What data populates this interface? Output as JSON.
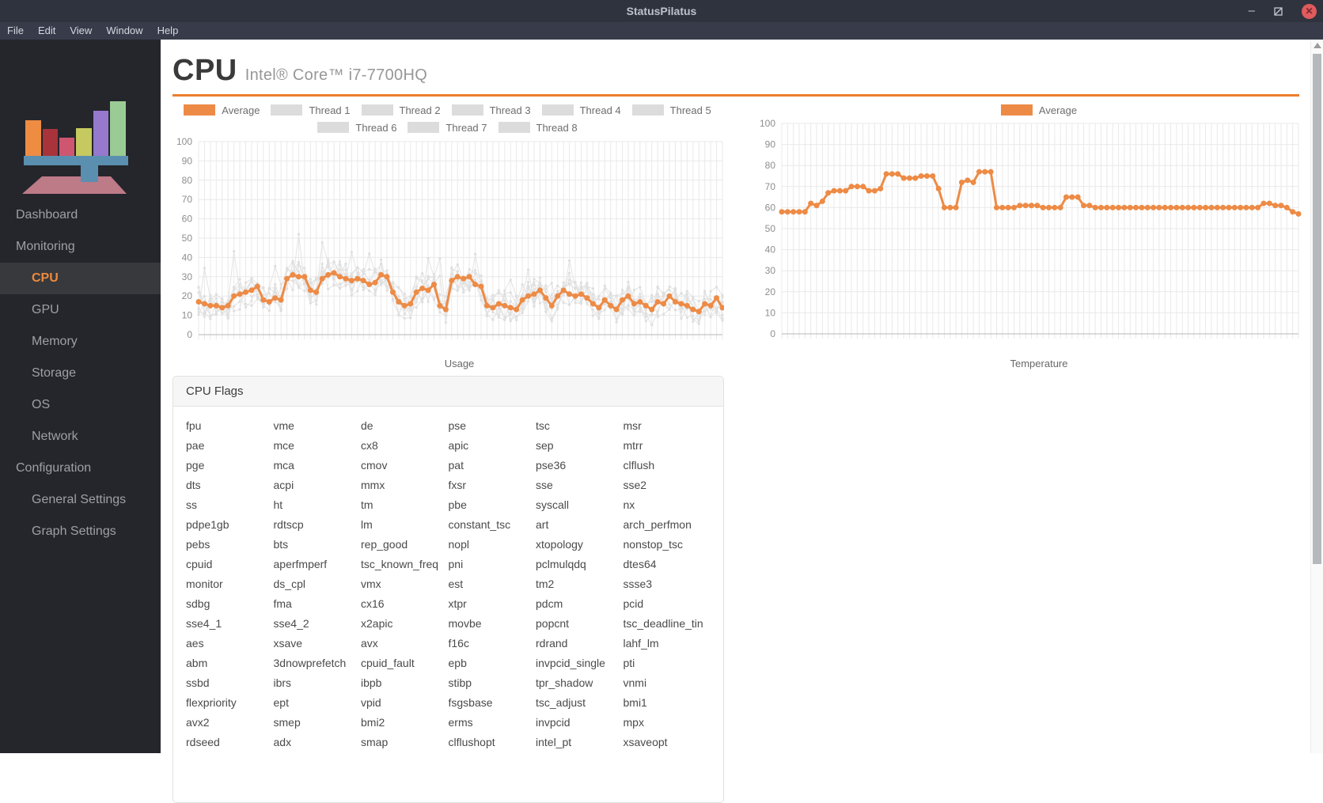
{
  "window": {
    "title": "StatusPilatus",
    "minimize_label": "–",
    "close_label": "✕"
  },
  "menu": {
    "items": [
      "File",
      "Edit",
      "View",
      "Window",
      "Help"
    ]
  },
  "sidebar": {
    "items": [
      {
        "label": "Dashboard",
        "level": 0,
        "selected": false
      },
      {
        "label": "Monitoring",
        "level": 0,
        "selected": false
      },
      {
        "label": "CPU",
        "level": 1,
        "selected": true
      },
      {
        "label": "GPU",
        "level": 1,
        "selected": false
      },
      {
        "label": "Memory",
        "level": 1,
        "selected": false
      },
      {
        "label": "Storage",
        "level": 1,
        "selected": false
      },
      {
        "label": "OS",
        "level": 1,
        "selected": false
      },
      {
        "label": "Network",
        "level": 1,
        "selected": false
      },
      {
        "label": "Configuration",
        "level": 0,
        "selected": false
      },
      {
        "label": "General Settings",
        "level": 1,
        "selected": false
      },
      {
        "label": "Graph Settings",
        "level": 1,
        "selected": false
      }
    ]
  },
  "page": {
    "title": "CPU",
    "subtitle": "Intel® Core™ i7-7700HQ"
  },
  "colors": {
    "accent_orange": "#ed8b46",
    "rule_orange": "#ec7f2f",
    "thread_gray": "#dcdcdc",
    "grid": "#e9e9e9",
    "axis_line": "#b7b7b7",
    "tick_text": "#8e8e8e"
  },
  "chart_data": [
    {
      "type": "line",
      "xlabel": "Usage",
      "ylabel": "",
      "ylim": [
        0,
        100
      ],
      "ytick_step": 10,
      "grid": true,
      "legend_position": "top",
      "legend": [
        "Average",
        "Thread 1",
        "Thread 2",
        "Thread 3",
        "Thread 4",
        "Thread 5",
        "Thread 6",
        "Thread 7",
        "Thread 8"
      ],
      "series": [
        {
          "name": "Average",
          "values": [
            17,
            16,
            15,
            15,
            14,
            15,
            20,
            21,
            22,
            23,
            25,
            18,
            17,
            19,
            18,
            29,
            31,
            30,
            30,
            23,
            22,
            29,
            31,
            32,
            30,
            29,
            28,
            29,
            28,
            26,
            27,
            31,
            30,
            22,
            17,
            15,
            16,
            22,
            24,
            23,
            26,
            15,
            13,
            28,
            30,
            29,
            30,
            26,
            25,
            15,
            14,
            16,
            15,
            14,
            13,
            18,
            20,
            21,
            23,
            19,
            15,
            20,
            23,
            21,
            20,
            21,
            19,
            16,
            14,
            18,
            15,
            13,
            18,
            20,
            16,
            17,
            15,
            13,
            17,
            16,
            20,
            17,
            16,
            15,
            13,
            12,
            16,
            15,
            19,
            14
          ]
        }
      ],
      "background_thread_count": 8
    },
    {
      "type": "line",
      "xlabel": "Temperature",
      "ylabel": "",
      "ylim": [
        0,
        100
      ],
      "ytick_step": 10,
      "grid": true,
      "legend_position": "top",
      "legend": [
        "Average"
      ],
      "series": [
        {
          "name": "Average",
          "values": [
            58,
            58,
            58,
            58,
            58,
            62,
            61,
            63,
            67,
            68,
            68,
            68,
            70,
            70,
            70,
            68,
            68,
            69,
            76,
            76,
            76,
            74,
            74,
            74,
            75,
            75,
            75,
            69,
            60,
            60,
            60,
            72,
            73,
            72,
            77,
            77,
            77,
            60,
            60,
            60,
            60,
            61,
            61,
            61,
            61,
            60,
            60,
            60,
            60,
            65,
            65,
            65,
            61,
            61,
            60,
            60,
            60,
            60,
            60,
            60,
            60,
            60,
            60,
            60,
            60,
            60,
            60,
            60,
            60,
            60,
            60,
            60,
            60,
            60,
            60,
            60,
            60,
            60,
            60,
            60,
            60,
            60,
            60,
            62,
            62,
            61,
            61,
            60,
            58,
            57
          ]
        }
      ],
      "background_thread_count": 0
    }
  ],
  "cpu_flags": {
    "title": "CPU Flags",
    "flags": [
      "fpu",
      "vme",
      "de",
      "pse",
      "tsc",
      "msr",
      "pae",
      "mce",
      "cx8",
      "apic",
      "sep",
      "mtrr",
      "pge",
      "mca",
      "cmov",
      "pat",
      "pse36",
      "clflush",
      "dts",
      "acpi",
      "mmx",
      "fxsr",
      "sse",
      "sse2",
      "ss",
      "ht",
      "tm",
      "pbe",
      "syscall",
      "nx",
      "pdpe1gb",
      "rdtscp",
      "lm",
      "constant_tsc",
      "art",
      "arch_perfmon",
      "pebs",
      "bts",
      "rep_good",
      "nopl",
      "xtopology",
      "nonstop_tsc",
      "cpuid",
      "aperfmperf",
      "tsc_known_freq",
      "pni",
      "pclmulqdq",
      "dtes64",
      "monitor",
      "ds_cpl",
      "vmx",
      "est",
      "tm2",
      "ssse3",
      "sdbg",
      "fma",
      "cx16",
      "xtpr",
      "pdcm",
      "pcid",
      "sse4_1",
      "sse4_2",
      "x2apic",
      "movbe",
      "popcnt",
      "tsc_deadline_tin",
      "aes",
      "xsave",
      "avx",
      "f16c",
      "rdrand",
      "lahf_lm",
      "abm",
      "3dnowprefetch",
      "cpuid_fault",
      "epb",
      "invpcid_single",
      "pti",
      "ssbd",
      "ibrs",
      "ibpb",
      "stibp",
      "tpr_shadow",
      "vnmi",
      "flexpriority",
      "ept",
      "vpid",
      "fsgsbase",
      "tsc_adjust",
      "bmi1",
      "avx2",
      "smep",
      "bmi2",
      "erms",
      "invpcid",
      "mpx",
      "rdseed",
      "adx",
      "smap",
      "clflushopt",
      "intel_pt",
      "xsaveopt"
    ]
  }
}
